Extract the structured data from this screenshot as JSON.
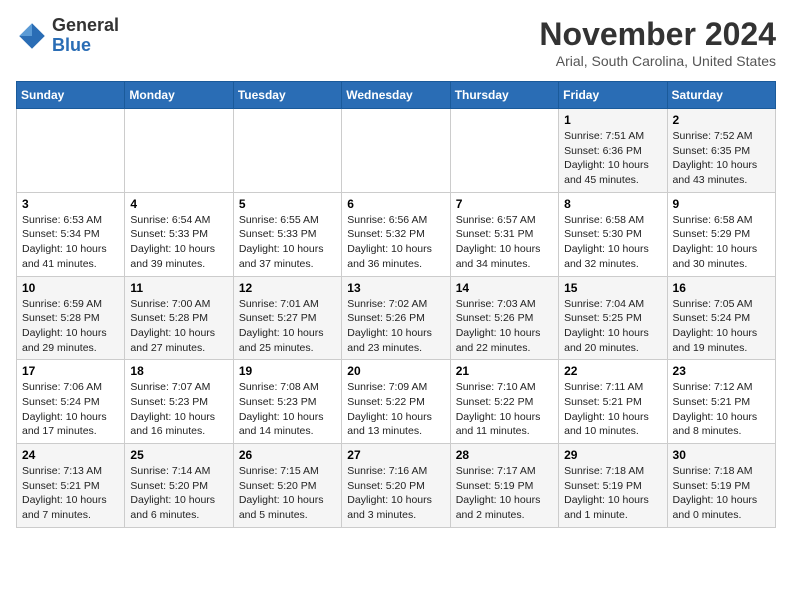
{
  "header": {
    "logo_general": "General",
    "logo_blue": "Blue",
    "month_title": "November 2024",
    "location": "Arial, South Carolina, United States"
  },
  "weekdays": [
    "Sunday",
    "Monday",
    "Tuesday",
    "Wednesday",
    "Thursday",
    "Friday",
    "Saturday"
  ],
  "weeks": [
    [
      {
        "day": "",
        "detail": ""
      },
      {
        "day": "",
        "detail": ""
      },
      {
        "day": "",
        "detail": ""
      },
      {
        "day": "",
        "detail": ""
      },
      {
        "day": "",
        "detail": ""
      },
      {
        "day": "1",
        "detail": "Sunrise: 7:51 AM\nSunset: 6:36 PM\nDaylight: 10 hours\nand 45 minutes."
      },
      {
        "day": "2",
        "detail": "Sunrise: 7:52 AM\nSunset: 6:35 PM\nDaylight: 10 hours\nand 43 minutes."
      }
    ],
    [
      {
        "day": "3",
        "detail": "Sunrise: 6:53 AM\nSunset: 5:34 PM\nDaylight: 10 hours\nand 41 minutes."
      },
      {
        "day": "4",
        "detail": "Sunrise: 6:54 AM\nSunset: 5:33 PM\nDaylight: 10 hours\nand 39 minutes."
      },
      {
        "day": "5",
        "detail": "Sunrise: 6:55 AM\nSunset: 5:33 PM\nDaylight: 10 hours\nand 37 minutes."
      },
      {
        "day": "6",
        "detail": "Sunrise: 6:56 AM\nSunset: 5:32 PM\nDaylight: 10 hours\nand 36 minutes."
      },
      {
        "day": "7",
        "detail": "Sunrise: 6:57 AM\nSunset: 5:31 PM\nDaylight: 10 hours\nand 34 minutes."
      },
      {
        "day": "8",
        "detail": "Sunrise: 6:58 AM\nSunset: 5:30 PM\nDaylight: 10 hours\nand 32 minutes."
      },
      {
        "day": "9",
        "detail": "Sunrise: 6:58 AM\nSunset: 5:29 PM\nDaylight: 10 hours\nand 30 minutes."
      }
    ],
    [
      {
        "day": "10",
        "detail": "Sunrise: 6:59 AM\nSunset: 5:28 PM\nDaylight: 10 hours\nand 29 minutes."
      },
      {
        "day": "11",
        "detail": "Sunrise: 7:00 AM\nSunset: 5:28 PM\nDaylight: 10 hours\nand 27 minutes."
      },
      {
        "day": "12",
        "detail": "Sunrise: 7:01 AM\nSunset: 5:27 PM\nDaylight: 10 hours\nand 25 minutes."
      },
      {
        "day": "13",
        "detail": "Sunrise: 7:02 AM\nSunset: 5:26 PM\nDaylight: 10 hours\nand 23 minutes."
      },
      {
        "day": "14",
        "detail": "Sunrise: 7:03 AM\nSunset: 5:26 PM\nDaylight: 10 hours\nand 22 minutes."
      },
      {
        "day": "15",
        "detail": "Sunrise: 7:04 AM\nSunset: 5:25 PM\nDaylight: 10 hours\nand 20 minutes."
      },
      {
        "day": "16",
        "detail": "Sunrise: 7:05 AM\nSunset: 5:24 PM\nDaylight: 10 hours\nand 19 minutes."
      }
    ],
    [
      {
        "day": "17",
        "detail": "Sunrise: 7:06 AM\nSunset: 5:24 PM\nDaylight: 10 hours\nand 17 minutes."
      },
      {
        "day": "18",
        "detail": "Sunrise: 7:07 AM\nSunset: 5:23 PM\nDaylight: 10 hours\nand 16 minutes."
      },
      {
        "day": "19",
        "detail": "Sunrise: 7:08 AM\nSunset: 5:23 PM\nDaylight: 10 hours\nand 14 minutes."
      },
      {
        "day": "20",
        "detail": "Sunrise: 7:09 AM\nSunset: 5:22 PM\nDaylight: 10 hours\nand 13 minutes."
      },
      {
        "day": "21",
        "detail": "Sunrise: 7:10 AM\nSunset: 5:22 PM\nDaylight: 10 hours\nand 11 minutes."
      },
      {
        "day": "22",
        "detail": "Sunrise: 7:11 AM\nSunset: 5:21 PM\nDaylight: 10 hours\nand 10 minutes."
      },
      {
        "day": "23",
        "detail": "Sunrise: 7:12 AM\nSunset: 5:21 PM\nDaylight: 10 hours\nand 8 minutes."
      }
    ],
    [
      {
        "day": "24",
        "detail": "Sunrise: 7:13 AM\nSunset: 5:21 PM\nDaylight: 10 hours\nand 7 minutes."
      },
      {
        "day": "25",
        "detail": "Sunrise: 7:14 AM\nSunset: 5:20 PM\nDaylight: 10 hours\nand 6 minutes."
      },
      {
        "day": "26",
        "detail": "Sunrise: 7:15 AM\nSunset: 5:20 PM\nDaylight: 10 hours\nand 5 minutes."
      },
      {
        "day": "27",
        "detail": "Sunrise: 7:16 AM\nSunset: 5:20 PM\nDaylight: 10 hours\nand 3 minutes."
      },
      {
        "day": "28",
        "detail": "Sunrise: 7:17 AM\nSunset: 5:19 PM\nDaylight: 10 hours\nand 2 minutes."
      },
      {
        "day": "29",
        "detail": "Sunrise: 7:18 AM\nSunset: 5:19 PM\nDaylight: 10 hours\nand 1 minute."
      },
      {
        "day": "30",
        "detail": "Sunrise: 7:18 AM\nSunset: 5:19 PM\nDaylight: 10 hours\nand 0 minutes."
      }
    ]
  ]
}
